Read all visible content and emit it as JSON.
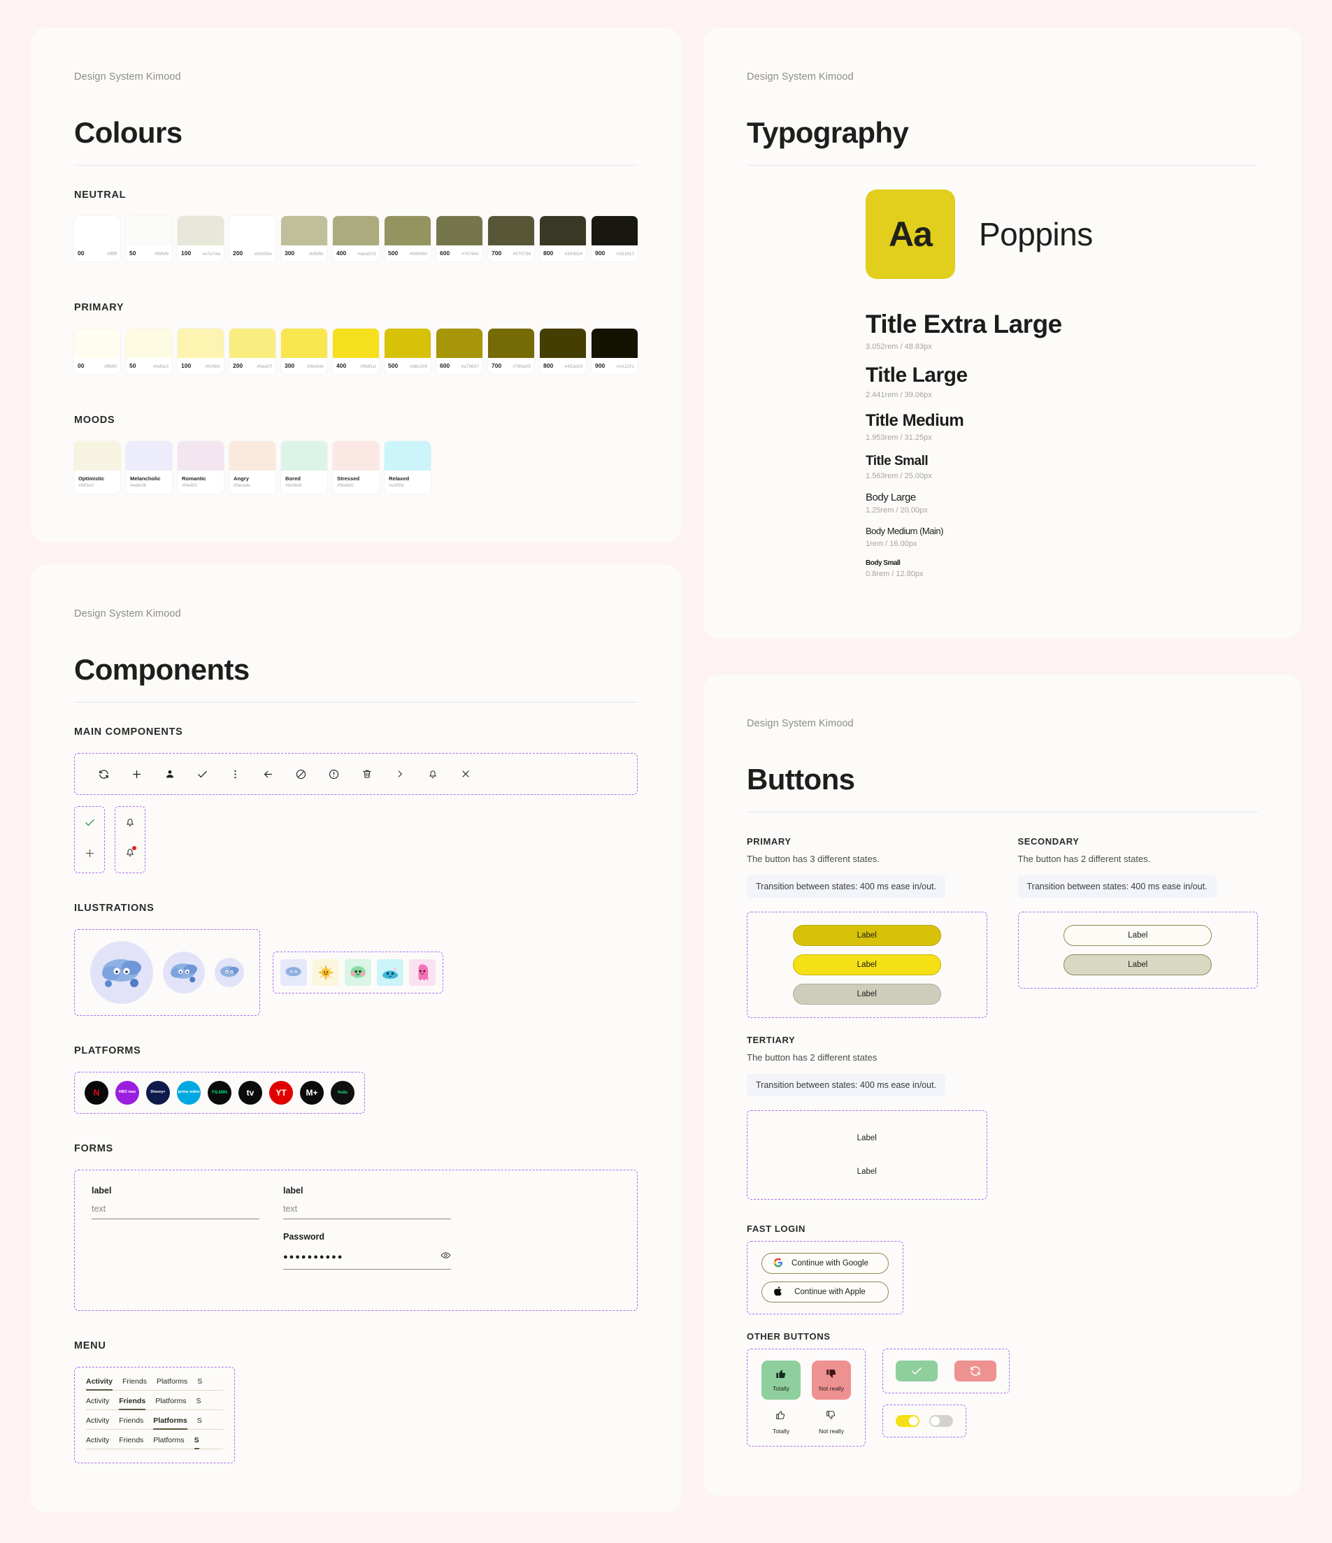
{
  "brand": "Design System Kimood",
  "cards": {
    "colours": {
      "kicker": "Design System Kimood",
      "title": "Colours",
      "neutral_label": "NEUTRAL",
      "primary_label": "PRIMARY",
      "moods_label": "MOODS",
      "neutral": [
        {
          "step": "00",
          "hex": "#ffffff"
        },
        {
          "step": "50",
          "hex": "#fbfbf9"
        },
        {
          "step": "100",
          "hex": "#e7e7da"
        },
        {
          "step": "200",
          "hex": "#d3d3bo"
        },
        {
          "step": "300",
          "hex": "#bfbf9c"
        },
        {
          "step": "400",
          "hex": "#abab7d"
        },
        {
          "step": "500",
          "hex": "#949460"
        },
        {
          "step": "600",
          "hex": "#76764c"
        },
        {
          "step": "700",
          "hex": "#575738"
        },
        {
          "step": "800",
          "hex": "#383824"
        },
        {
          "step": "900",
          "hex": "#181810"
        }
      ],
      "primary": [
        {
          "step": "00",
          "hex": "#fffdf0"
        },
        {
          "step": "50",
          "hex": "#fefbe3"
        },
        {
          "step": "100",
          "hex": "#fcf4b0"
        },
        {
          "step": "200",
          "hex": "#faed7f"
        },
        {
          "step": "300",
          "hex": "#f8e64e"
        },
        {
          "step": "400",
          "hex": "#f6df1d"
        },
        {
          "step": "500",
          "hex": "#d8c209"
        },
        {
          "step": "600",
          "hex": "#a79607"
        },
        {
          "step": "700",
          "hex": "#766a05"
        },
        {
          "step": "800",
          "hex": "#453e03"
        },
        {
          "step": "900",
          "hex": "#141201"
        }
      ],
      "moods": [
        {
          "name": "Optimistic",
          "hex": "#f6f3e0"
        },
        {
          "name": "Melancholic",
          "hex": "#edecfb"
        },
        {
          "name": "Romantic",
          "hex": "#f4e6f1"
        },
        {
          "name": "Angry",
          "hex": "#faeade"
        },
        {
          "name": "Bored",
          "hex": "#dcf4e8"
        },
        {
          "name": "Stressed",
          "hex": "#fbe8e5"
        },
        {
          "name": "Relaxed",
          "hex": "#cbf5fa"
        }
      ]
    },
    "typography": {
      "kicker": "Design System Kimood",
      "title": "Typography",
      "sample_glyph": "Aa",
      "font_name": "Poppins",
      "tile_color": "#e2ce1c",
      "scale": [
        {
          "name": "Title Extra Large",
          "spec": "3.052rem / 48.83px",
          "size": 37,
          "weight": 700
        },
        {
          "name": "Title Large",
          "spec": "2.441rem / 39.06px",
          "size": 30,
          "weight": 700
        },
        {
          "name": "Title Medium",
          "spec": "1.953rem / 31.25px",
          "size": 24,
          "weight": 700
        },
        {
          "name": "Title Small",
          "spec": "1.563rem / 25.00px",
          "size": 19,
          "weight": 700
        },
        {
          "name": "Body Large",
          "spec": "1.25rem / 20.00px",
          "size": 15,
          "weight": 500
        },
        {
          "name": "Body Medium (Main)",
          "spec": "1rem / 16.00px",
          "size": 13,
          "weight": 500
        },
        {
          "name": "Body Small",
          "spec": "0.8rem / 12.80px",
          "size": 10,
          "weight": 600
        }
      ]
    },
    "components": {
      "kicker": "Design System Kimood",
      "title": "Components",
      "main_label": "MAIN COMPONENTS",
      "illustrations_label": "ILUSTRATIONS",
      "platforms_label": "PLATFORMS",
      "forms_label": "FORMS",
      "menu_label": "MENU",
      "icons": [
        "refresh-icon",
        "plus-icon",
        "person-icon",
        "check-icon",
        "more-vertical-icon",
        "arrow-left-icon",
        "block-icon",
        "alert-icon",
        "trash-icon",
        "chevron-right-icon",
        "bell-icon",
        "close-icon"
      ],
      "mini_icons_col1": [
        "check-icon",
        "plus-icon"
      ],
      "mini_icons_col2": [
        "bell-icon",
        "bell-alert-icon"
      ],
      "platforms": [
        {
          "name": "Netflix",
          "short": "N",
          "bg": "#090909",
          "fg": "#e50914"
        },
        {
          "name": "HBO Max",
          "short": "HBO max",
          "bg": "#9b1de0",
          "fg": "#ffffff"
        },
        {
          "name": "Disney+",
          "short": "Disney+",
          "bg": "#0d1a4a",
          "fg": "#ffffff"
        },
        {
          "name": "Prime Video",
          "short": "prime video",
          "bg": "#00a8e1",
          "fg": "#ffffff"
        },
        {
          "name": "Filmin",
          "short": "FILMIN",
          "bg": "#0b0b0b",
          "fg": "#00e07a"
        },
        {
          "name": "Apple TV",
          "short": "tv",
          "bg": "#0b0b0b",
          "fg": "#ffffff"
        },
        {
          "name": "YouTube",
          "short": "YT",
          "bg": "#e00000",
          "fg": "#ffffff"
        },
        {
          "name": "Movistar+",
          "short": "M+",
          "bg": "#0b0b0b",
          "fg": "#ffffff"
        },
        {
          "name": "Hulu",
          "short": "hulu",
          "bg": "#101010",
          "fg": "#1ce783"
        }
      ],
      "forms": {
        "left": {
          "label": "label",
          "value": "text"
        },
        "right_text": {
          "label": "label",
          "value": "text"
        },
        "right_password": {
          "label": "Password",
          "value": "●●●●●●●●●●",
          "toggle_icon": "eye-icon"
        }
      },
      "menu": {
        "items": [
          "Activity",
          "Friends",
          "Platforms",
          "S"
        ],
        "rows": [
          0,
          1,
          2,
          3
        ]
      }
    },
    "buttons": {
      "kicker": "Design System Kimood",
      "title": "Buttons",
      "primary": {
        "label": "PRIMARY",
        "desc": "The button has 3 different states.",
        "note": "Transition between states: 400 ms ease in/out.",
        "items": [
          "Label",
          "Label",
          "Label"
        ]
      },
      "secondary": {
        "label": "SECONDARY",
        "desc": "The button has 2 different states.",
        "note": "Transition between states: 400 ms ease in/out.",
        "items": [
          "Label",
          "Label"
        ]
      },
      "tertiary": {
        "label": "TERTIARY",
        "desc": "The button has 2 different states",
        "note": "Transition between states: 400 ms ease in/out.",
        "items": [
          "Label",
          "Label"
        ]
      },
      "fast_login": {
        "label": "FAST LOGIN",
        "google": "Continue with Google",
        "apple": "Continue with Apple"
      },
      "other": {
        "label": "OTHER BUTTONS",
        "yes": "Totally",
        "no": "Not really",
        "yes_plain": "Totally",
        "no_plain": "Not really"
      }
    }
  }
}
